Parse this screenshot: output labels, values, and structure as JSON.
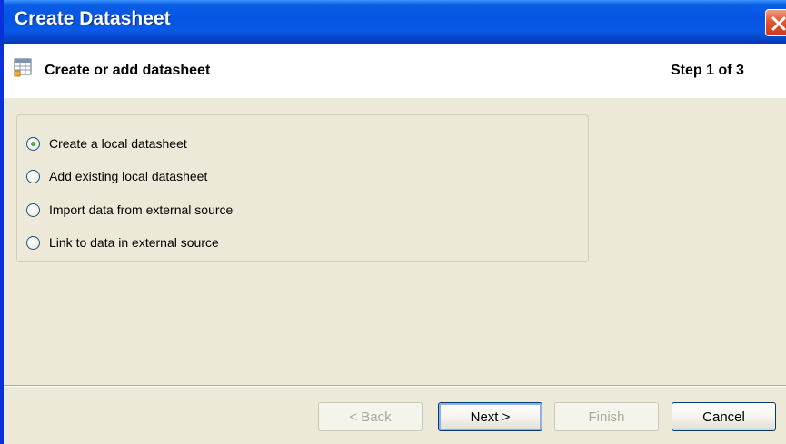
{
  "window": {
    "title": "Create Datasheet"
  },
  "header": {
    "title": "Create or add datasheet",
    "step": "Step 1 of 3",
    "icon": "datasheet-icon"
  },
  "options": [
    {
      "label": "Create a local datasheet",
      "checked": true
    },
    {
      "label": "Add existing local datasheet",
      "checked": false
    },
    {
      "label": "Import data from external source",
      "checked": false
    },
    {
      "label": "Link to data in external source",
      "checked": false
    }
  ],
  "buttons": {
    "back": "< Back",
    "next": "Next >",
    "finish": "Finish",
    "cancel": "Cancel"
  },
  "colors": {
    "titlebar": "#0554E3",
    "dialog_bg": "#ECE9D8",
    "close": "#E2562F",
    "radio_check": "#1A9A1A"
  }
}
